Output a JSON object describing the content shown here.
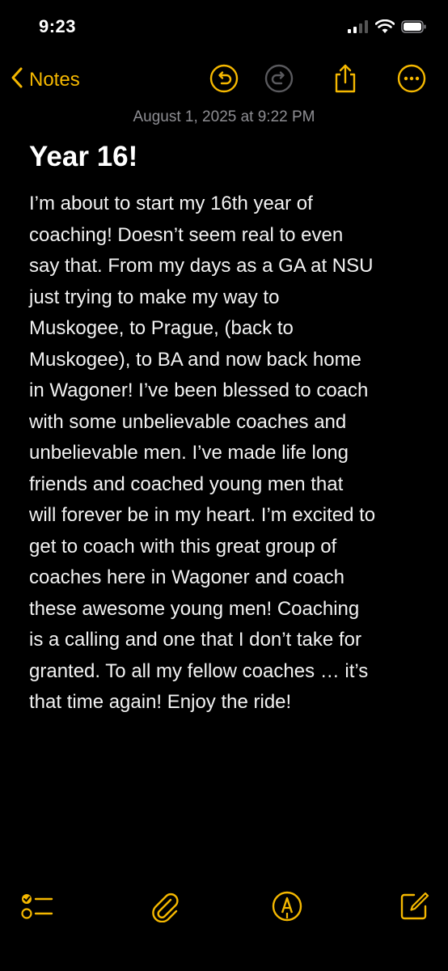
{
  "status_bar": {
    "time": "9:23",
    "icons": [
      "cellular-signal-icon",
      "wifi-icon",
      "battery-icon"
    ]
  },
  "nav": {
    "back_label": "Notes",
    "icons": [
      "undo-icon",
      "redo-icon",
      "share-icon",
      "more-icon"
    ]
  },
  "note": {
    "date": "August 1, 2025 at 9:22 PM",
    "title": "Year 16!",
    "body_lines": [
      "I’m about to start my 16th year of",
      "coaching! Doesn’t seem real to even",
      "say that. From my days as a GA at NSU",
      "just trying to make my way to",
      "Muskogee, to Prague, (back to",
      "Muskogee), to BA and now back home",
      "in Wagoner! I’ve been blessed to coach",
      "with some unbelievable coaches and",
      "unbelievable men. I’ve made life long",
      "friends and coached young men that",
      "will forever be in my heart. I’m excited to",
      "get to coach with this great group of",
      "coaches here in Wagoner and coach",
      "these awesome young men! Coaching",
      "is a calling and one that I don’t take for",
      "granted. To all my fellow coaches … it’s",
      "that time again! Enjoy the ride!"
    ]
  },
  "toolbar": {
    "icons": [
      "checklist-icon",
      "paperclip-icon",
      "markup-pen-icon",
      "compose-icon"
    ]
  },
  "colors": {
    "accent": "#f5b800",
    "background": "#000000",
    "text": "#ffffff",
    "secondary_text": "#8e8e93",
    "disabled": "#5a5a5e"
  }
}
